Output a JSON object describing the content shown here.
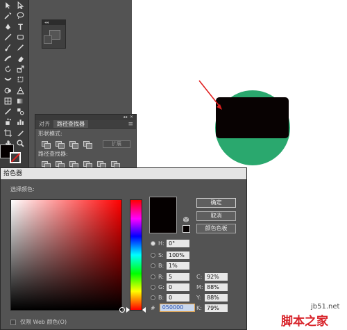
{
  "toolbar": {
    "tools": [
      [
        "selection-tool",
        "direct-select-tool"
      ],
      [
        "magic-wand-tool",
        "lasso-tool"
      ],
      [
        "pen-tool",
        "type-tool"
      ],
      [
        "line-tool",
        "rectangle-tool"
      ],
      [
        "paintbrush-tool",
        "pencil-tool"
      ],
      [
        "blob-brush-tool",
        "eraser-tool"
      ],
      [
        "rotate-tool",
        "scale-tool"
      ],
      [
        "width-tool",
        "free-transform-tool"
      ],
      [
        "shape-builder-tool",
        "perspective-grid-tool"
      ],
      [
        "mesh-tool",
        "gradient-tool"
      ],
      [
        "eyedropper-tool",
        "blend-tool"
      ],
      [
        "symbol-sprayer-tool",
        "column-graph-tool"
      ],
      [
        "artboard-tool",
        "slice-tool"
      ],
      [
        "hand-tool",
        "zoom-tool"
      ]
    ]
  },
  "pathfinder_panel": {
    "tabs": [
      "对齐",
      "路径查找器"
    ],
    "active_tab": "路径查找器",
    "shape_modes_label": "形状模式:",
    "pathfinders_label": "路径查找器:",
    "expand_button": "扩展"
  },
  "color_picker": {
    "title": "拾色器",
    "select_color_label": "选择颜色:",
    "ok_button": "确定",
    "cancel_button": "取消",
    "swatches_button": "颜色色板",
    "current_color": "#050000",
    "fields": {
      "H": {
        "label": "H:",
        "value": "0°"
      },
      "S": {
        "label": "S:",
        "value": "100%"
      },
      "B": {
        "label": "B:",
        "value": "1%"
      },
      "R": {
        "label": "R:",
        "value": "5"
      },
      "G": {
        "label": "G:",
        "value": "0"
      },
      "Bl": {
        "label": "B:",
        "value": "0"
      },
      "C": {
        "label": "C:",
        "value": "92%"
      },
      "M": {
        "label": "M:",
        "value": "88%"
      },
      "Y": {
        "label": "Y:",
        "value": "88%"
      },
      "K": {
        "label": "K:",
        "value": "79%"
      }
    },
    "hex_label": "#",
    "hex_value": "050000",
    "web_only_label": "仅限 Web 颜色(O)"
  },
  "artwork": {
    "circle_color": "#2aa86e",
    "rect_color": "#080202",
    "arrow_color": "#e02020"
  },
  "watermark": {
    "site": "jb51.net",
    "brand": "脚本之家"
  }
}
